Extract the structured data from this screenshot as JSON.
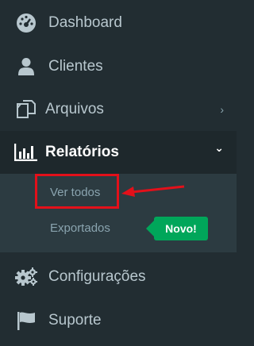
{
  "colors": {
    "sidebar_bg": "#222d32",
    "submenu_bg": "#2c3b41",
    "active_bg": "#1e282c",
    "text": "#b8c7ce",
    "active_text": "#ffffff",
    "badge_bg": "#00a65a",
    "annotation_red": "#e3101a"
  },
  "menu": {
    "dashboard": {
      "label": "Dashboard",
      "icon": "dashboard-icon"
    },
    "clientes": {
      "label": "Clientes",
      "icon": "user-icon"
    },
    "arquivos": {
      "label": "Arquivos",
      "icon": "files-icon",
      "chevron": "›"
    },
    "relatorios": {
      "label": "Relatórios",
      "icon": "bar-chart-icon",
      "chevron": "⌄"
    },
    "configuracoes": {
      "label": "Configurações",
      "icon": "gears-icon"
    },
    "suporte": {
      "label": "Suporte",
      "icon": "flag-icon"
    }
  },
  "submenu": {
    "ver_todos": "Ver todos",
    "exportados": "Exportados",
    "badge": "Novo!"
  }
}
